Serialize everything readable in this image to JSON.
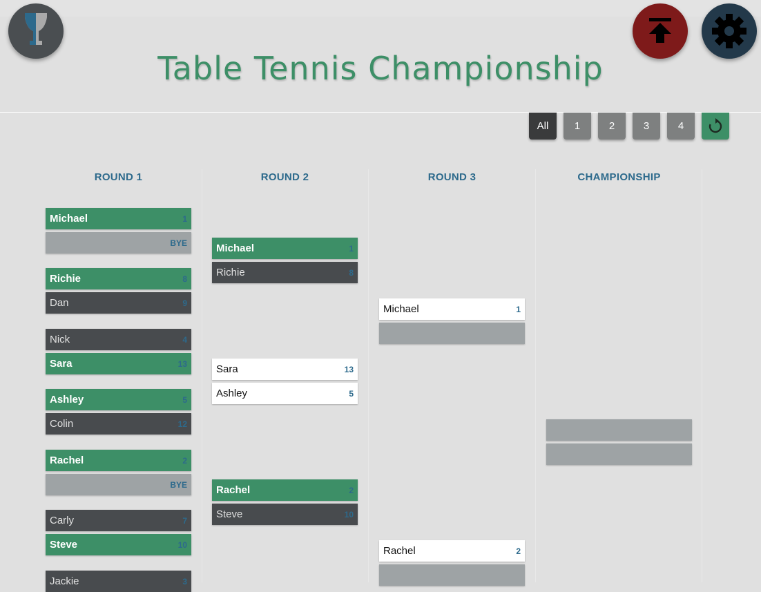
{
  "title": "Table Tennis Championship",
  "colors": {
    "background": "#e0e0e0",
    "accent_green": "#3d8f67",
    "winner_slot": "#3d8f67",
    "loser_slot": "#484b4e",
    "empty_slot": "#9ea3a5",
    "score_blue": "#2d6a8c",
    "upload_button": "#7e1a1a",
    "settings_button": "#23394a",
    "trophy_button": "#4a4e51"
  },
  "icons": {
    "trophy": "trophy-icon",
    "upload": "upload-to-top-icon",
    "settings": "gear-icon",
    "refresh": "refresh-icon"
  },
  "filters": {
    "all": "All",
    "r1": "1",
    "r2": "2",
    "r3": "3",
    "r4": "4"
  },
  "rounds": {
    "r1": "ROUND 1",
    "r2": "ROUND 2",
    "r3": "ROUND 3",
    "championship": "CHAMPIONSHIP"
  },
  "round1": {
    "m1": {
      "a_name": "Michael",
      "a_score": "1",
      "b_name": "",
      "b_score": "BYE"
    },
    "m2": {
      "a_name": "Richie",
      "a_score": "8",
      "b_name": "Dan",
      "b_score": "9"
    },
    "m3": {
      "a_name": "Nick",
      "a_score": "4",
      "b_name": "Sara",
      "b_score": "13"
    },
    "m4": {
      "a_name": "Ashley",
      "a_score": "5",
      "b_name": "Colin",
      "b_score": "12"
    },
    "m5": {
      "a_name": "Rachel",
      "a_score": "2",
      "b_name": "",
      "b_score": "BYE"
    },
    "m6": {
      "a_name": "Carly",
      "a_score": "7",
      "b_name": "Steve",
      "b_score": "10"
    },
    "m7": {
      "a_name": "Jackie",
      "a_score": "3"
    }
  },
  "round2": {
    "m1": {
      "a_name": "Michael",
      "a_score": "1",
      "b_name": "Richie",
      "b_score": "8"
    },
    "m2": {
      "a_name": "Sara",
      "a_score": "13",
      "b_name": "Ashley",
      "b_score": "5"
    },
    "m3": {
      "a_name": "Rachel",
      "a_score": "2",
      "b_name": "Steve",
      "b_score": "10"
    }
  },
  "round3": {
    "m1": {
      "a_name": "Michael",
      "a_score": "1"
    },
    "m2": {
      "a_name": "Rachel",
      "a_score": "2"
    }
  }
}
